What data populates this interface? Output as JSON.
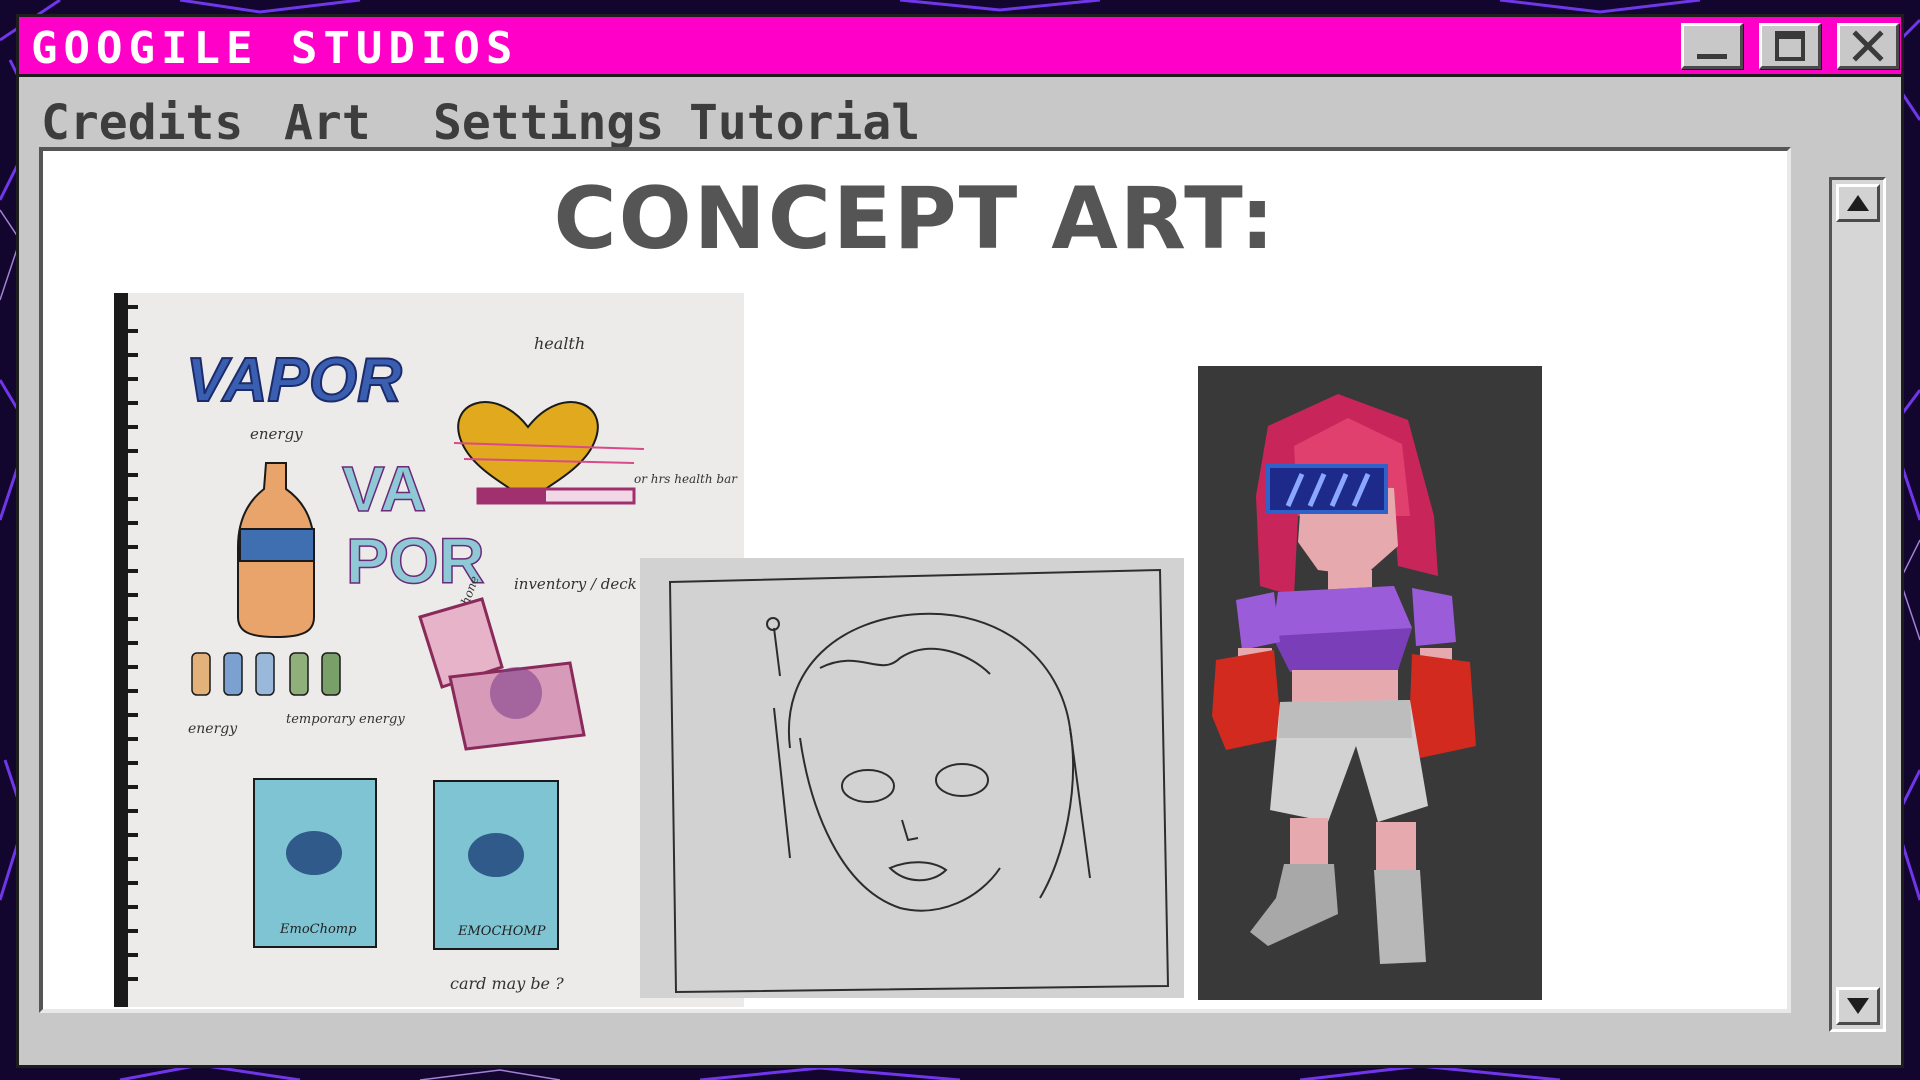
{
  "window": {
    "title": "GOOGILE STUDIOS",
    "title_color": "#ff00c8"
  },
  "controls": {
    "minimize_icon": "minimize-icon",
    "maximize_icon": "maximize-icon",
    "close_icon": "close-icon"
  },
  "menu": {
    "credits": "Credits",
    "art": "Art",
    "settings": "Settings",
    "tutorial": "Tutorial"
  },
  "main": {
    "heading": "CONCEPT ART:",
    "sketchbook": {
      "title_large": "VAPOR",
      "title_vertical_1": "VA",
      "title_vertical_2": "POR",
      "note_health": "health",
      "note_energy": "energy",
      "note_health_bar": "or hrs health bar",
      "note_inventory": "inventory / deck",
      "note_phone": "phone",
      "note_energy_small": "energy",
      "note_temp_energy": "temporary energy",
      "card_label_1": "EmoChomp",
      "card_label_2": "EMOCHOMP",
      "note_card": "card may be ?"
    }
  },
  "scrollbar": {
    "up_icon": "arrow-up-icon",
    "down_icon": "arrow-down-icon"
  }
}
